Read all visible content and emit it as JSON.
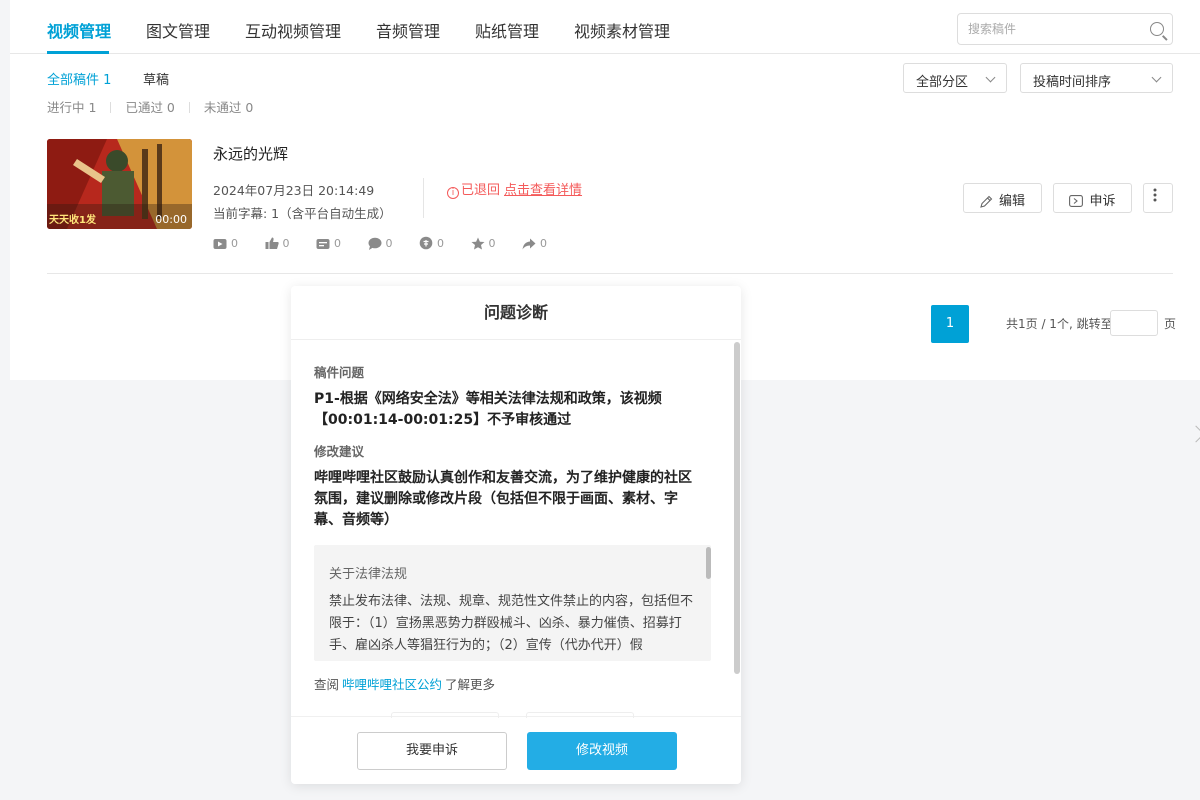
{
  "tabs": [
    {
      "label": "视频管理",
      "active": true
    },
    {
      "label": "图文管理"
    },
    {
      "label": "互动视频管理"
    },
    {
      "label": "音频管理"
    },
    {
      "label": "贴纸管理"
    },
    {
      "label": "视频素材管理"
    }
  ],
  "search": {
    "placeholder": "搜索稿件",
    "icon": "search-icon"
  },
  "subtabs": {
    "all": "全部稿件 1",
    "draft": "草稿"
  },
  "filters": {
    "in_progress": "进行中 1",
    "approved": "已通过 0",
    "rejected": "未通过 0"
  },
  "selects": {
    "category": "全部分区",
    "sort": "投稿时间排序"
  },
  "video": {
    "title": "永远的光辉",
    "date": "2024年07月23日 20:14:49",
    "subtitle": "当前字幕: 1（含平台自动生成）",
    "duration": "00:00",
    "thumb_caption": "天天收1发",
    "status": "已退回",
    "status_link": "点击查看详情",
    "stats": {
      "plays": "0",
      "likes": "0",
      "danmaku": "0",
      "comments": "0",
      "coins": "0",
      "favorites": "0",
      "shares": "0"
    },
    "edit_label": "编辑",
    "appeal_label": "申诉"
  },
  "pagination": {
    "current": "1",
    "info": "共1页 / 1个, 跳转至",
    "suffix": "页"
  },
  "modal": {
    "title": "问题诊断",
    "issue_label": "稿件问题",
    "issue_text": "P1-根据《网络安全法》等相关法律法规和政策，该视频【00:01:14-00:01:25】不予审核通过",
    "suggestion_label": "修改建议",
    "suggestion_text": "哔哩哔哩社区鼓励认真创作和友善交流，为了维护健康的社区氛围，建议删除或修改片段（包括但不限于画面、素材、字幕、音频等）",
    "legal_title": "关于法律法规",
    "legal_text": "禁止发布法律、法规、规章、规范性文件禁止的内容，包括但不限于：（1）宣扬黑恶势力群殴械斗、凶杀、暴力催债、招募打手、雇凶杀人等猖狂行为的；（2）宣传（代办代开）假",
    "more_prefix": "查阅",
    "more_link": "哔哩哔哩社区公约",
    "more_suffix": "了解更多",
    "appeal_button": "我要申诉",
    "modify_button": "修改视频"
  },
  "colors": {
    "accent": "#00a1d6",
    "danger": "#f45a5a",
    "primary_button": "#23ade5"
  }
}
